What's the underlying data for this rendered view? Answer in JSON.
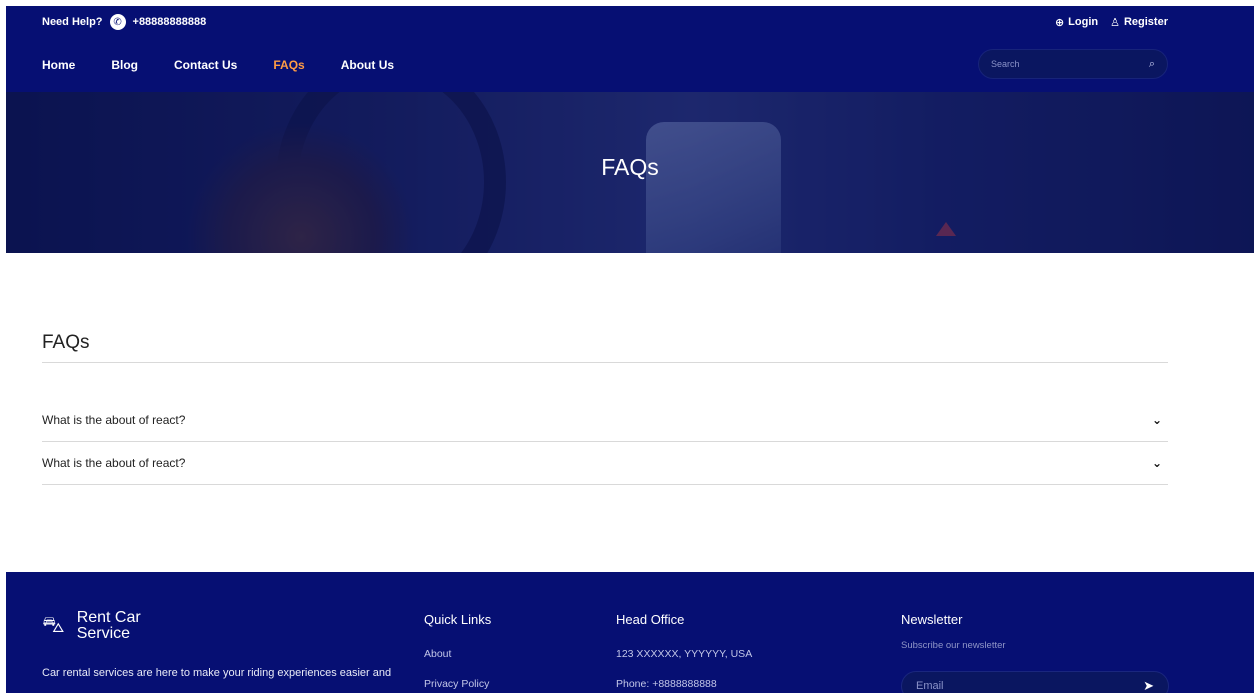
{
  "header": {
    "help_label": "Need Help?",
    "phone": "+88888888888",
    "login_label": "Login",
    "register_label": "Register",
    "nav": [
      {
        "label": "Home"
      },
      {
        "label": "Blog"
      },
      {
        "label": "Contact Us"
      },
      {
        "label": "FAQs"
      },
      {
        "label": "About Us"
      }
    ],
    "active_nav": "FAQs",
    "search_placeholder": "Search",
    "colors": {
      "background": "#060f73",
      "active": "#ff9c45"
    },
    "icons": [
      "phone-icon",
      "login-icon",
      "user-icon",
      "search-icon"
    ]
  },
  "hero": {
    "title": "FAQs"
  },
  "faq": {
    "title": "FAQs",
    "items": [
      {
        "question": "What is the about of react?"
      },
      {
        "question": "What is the about of react?"
      }
    ]
  },
  "footer": {
    "brand_name": "Rent Car Service",
    "about_text": "Car rental services are here to make your riding experiences easier and more convenient than ever before. Your ideal ride is",
    "quick_links": {
      "title": "Quick Links",
      "items": [
        "About",
        "Privacy Policy"
      ]
    },
    "head_office": {
      "title": "Head Office",
      "address": "123 XXXXXX, YYYYYY, USA",
      "phone": "Phone: +8888888888"
    },
    "newsletter": {
      "title": "Newsletter",
      "subtitle": "Subscribe our newsletter",
      "email_placeholder": "Email"
    }
  }
}
